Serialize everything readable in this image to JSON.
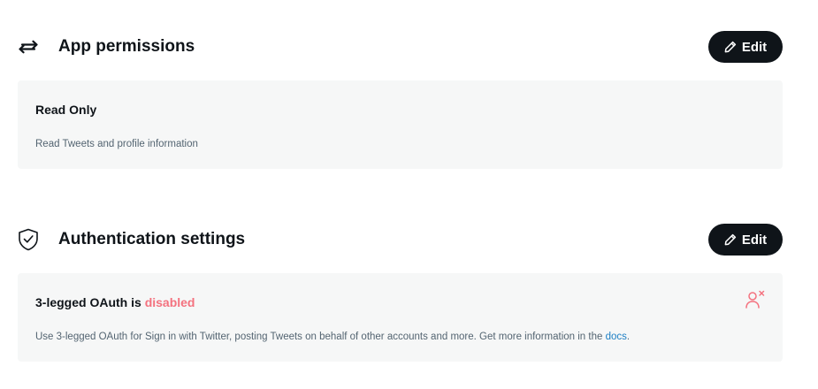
{
  "app_permissions": {
    "title": "App permissions",
    "icon": "arrows-exchange-icon",
    "edit_label": "Edit",
    "card": {
      "title": "Read Only",
      "description": "Read Tweets and profile information"
    }
  },
  "authentication": {
    "title": "Authentication settings",
    "icon": "shield-check-icon",
    "edit_label": "Edit",
    "card": {
      "title_prefix": "3-legged OAuth is",
      "status": "disabled",
      "status_color": "#f4727f",
      "description": "Use 3-legged OAuth for Sign in with Twitter, posting Tweets on behalf of other accounts and more. Get more information in the",
      "docs_link": "docs",
      "description_suffix": ".",
      "status_icon": "user-x-icon"
    }
  },
  "colors": {
    "button_bg": "#0f1419",
    "card_bg": "#f6f7f7",
    "link": "#1d7fc4"
  }
}
